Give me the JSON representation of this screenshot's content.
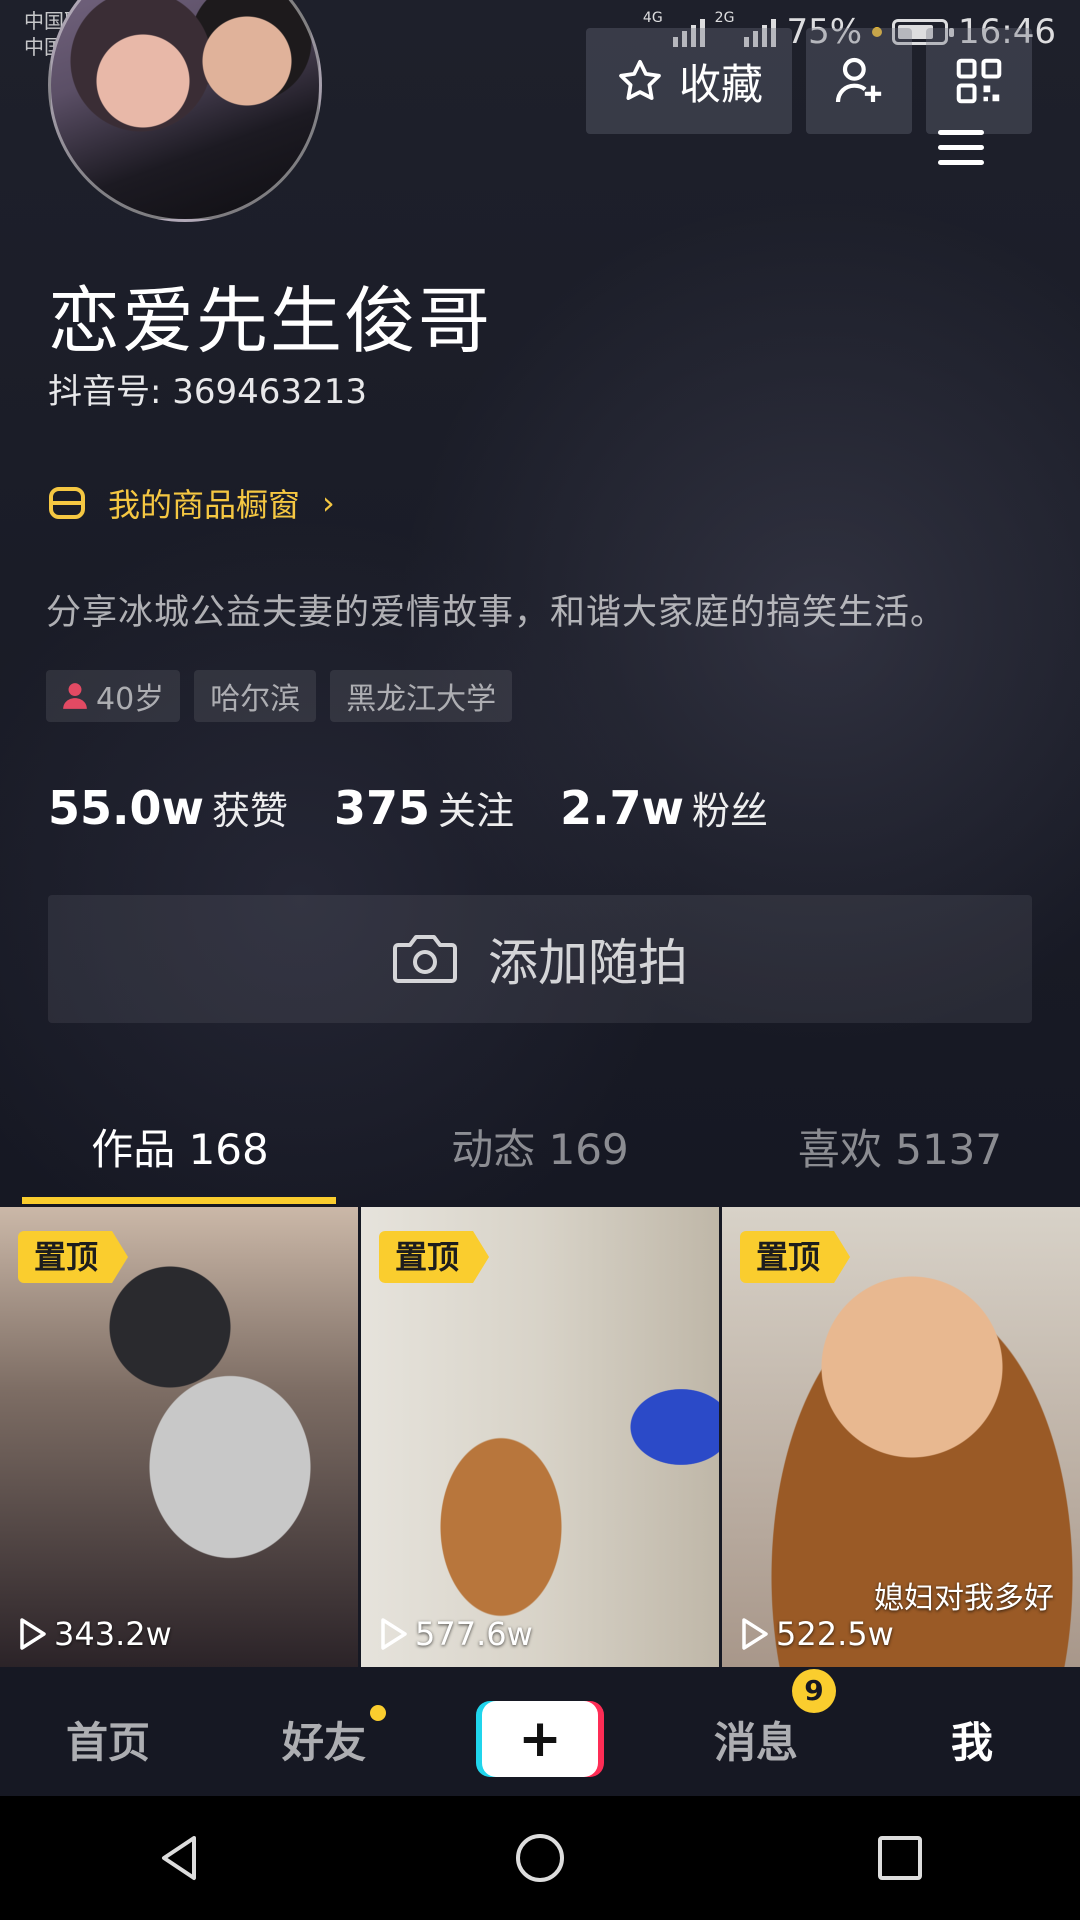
{
  "status_bar": {
    "carrier_1": "中国联通",
    "carrier_2": "中国移动",
    "network_1": "4G",
    "network_2": "2G",
    "battery": "75%",
    "time": "16:46"
  },
  "header": {
    "favorite_label": "收藏",
    "add_friend_icon": "person-plus-icon",
    "qr_icon": "qr-code-icon",
    "menu_icon": "hamburger-menu-icon"
  },
  "profile": {
    "name": "恋爱先生俊哥",
    "douyin_id": "抖音号: 369463213",
    "shop_label": "我的商品橱窗",
    "bio": "分享冰城公益夫妻的爱情故事，和谐大家庭的搞笑生活。",
    "tags": [
      "40岁",
      "哈尔滨",
      "黑龙江大学"
    ],
    "stats": [
      {
        "value": "55.0w",
        "label": "获赞"
      },
      {
        "value": "375",
        "label": "关注"
      },
      {
        "value": "2.7w",
        "label": "粉丝"
      }
    ],
    "add_snapshot_label": "添加随拍"
  },
  "tabs": [
    {
      "label": "作品 168",
      "active": true
    },
    {
      "label": "动态 169",
      "active": false
    },
    {
      "label": "喜欢 5137",
      "active": false
    }
  ],
  "videos": [
    {
      "pin": "置顶",
      "views": "343.2w",
      "caption": ""
    },
    {
      "pin": "置顶",
      "views": "577.6w",
      "caption": ""
    },
    {
      "pin": "置顶",
      "views": "522.5w",
      "caption": "媳妇对我多好"
    }
  ],
  "bottom_nav": {
    "home": "首页",
    "friends": "好友",
    "plus": "+",
    "messages": "消息",
    "messages_badge": "9",
    "me": "我"
  },
  "colors": {
    "accent": "#facd2e",
    "background": "#161823"
  }
}
